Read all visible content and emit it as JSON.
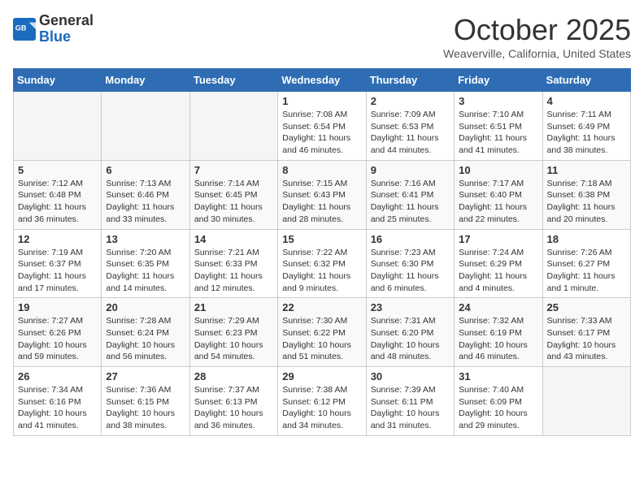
{
  "logo": {
    "line1": "General",
    "line2": "Blue"
  },
  "title": "October 2025",
  "subtitle": "Weaverville, California, United States",
  "days_of_week": [
    "Sunday",
    "Monday",
    "Tuesday",
    "Wednesday",
    "Thursday",
    "Friday",
    "Saturday"
  ],
  "weeks": [
    [
      {
        "day": "",
        "info": ""
      },
      {
        "day": "",
        "info": ""
      },
      {
        "day": "",
        "info": ""
      },
      {
        "day": "1",
        "info": "Sunrise: 7:08 AM\nSunset: 6:54 PM\nDaylight: 11 hours and 46 minutes."
      },
      {
        "day": "2",
        "info": "Sunrise: 7:09 AM\nSunset: 6:53 PM\nDaylight: 11 hours and 44 minutes."
      },
      {
        "day": "3",
        "info": "Sunrise: 7:10 AM\nSunset: 6:51 PM\nDaylight: 11 hours and 41 minutes."
      },
      {
        "day": "4",
        "info": "Sunrise: 7:11 AM\nSunset: 6:49 PM\nDaylight: 11 hours and 38 minutes."
      }
    ],
    [
      {
        "day": "5",
        "info": "Sunrise: 7:12 AM\nSunset: 6:48 PM\nDaylight: 11 hours and 36 minutes."
      },
      {
        "day": "6",
        "info": "Sunrise: 7:13 AM\nSunset: 6:46 PM\nDaylight: 11 hours and 33 minutes."
      },
      {
        "day": "7",
        "info": "Sunrise: 7:14 AM\nSunset: 6:45 PM\nDaylight: 11 hours and 30 minutes."
      },
      {
        "day": "8",
        "info": "Sunrise: 7:15 AM\nSunset: 6:43 PM\nDaylight: 11 hours and 28 minutes."
      },
      {
        "day": "9",
        "info": "Sunrise: 7:16 AM\nSunset: 6:41 PM\nDaylight: 11 hours and 25 minutes."
      },
      {
        "day": "10",
        "info": "Sunrise: 7:17 AM\nSunset: 6:40 PM\nDaylight: 11 hours and 22 minutes."
      },
      {
        "day": "11",
        "info": "Sunrise: 7:18 AM\nSunset: 6:38 PM\nDaylight: 11 hours and 20 minutes."
      }
    ],
    [
      {
        "day": "12",
        "info": "Sunrise: 7:19 AM\nSunset: 6:37 PM\nDaylight: 11 hours and 17 minutes."
      },
      {
        "day": "13",
        "info": "Sunrise: 7:20 AM\nSunset: 6:35 PM\nDaylight: 11 hours and 14 minutes."
      },
      {
        "day": "14",
        "info": "Sunrise: 7:21 AM\nSunset: 6:33 PM\nDaylight: 11 hours and 12 minutes."
      },
      {
        "day": "15",
        "info": "Sunrise: 7:22 AM\nSunset: 6:32 PM\nDaylight: 11 hours and 9 minutes."
      },
      {
        "day": "16",
        "info": "Sunrise: 7:23 AM\nSunset: 6:30 PM\nDaylight: 11 hours and 6 minutes."
      },
      {
        "day": "17",
        "info": "Sunrise: 7:24 AM\nSunset: 6:29 PM\nDaylight: 11 hours and 4 minutes."
      },
      {
        "day": "18",
        "info": "Sunrise: 7:26 AM\nSunset: 6:27 PM\nDaylight: 11 hours and 1 minute."
      }
    ],
    [
      {
        "day": "19",
        "info": "Sunrise: 7:27 AM\nSunset: 6:26 PM\nDaylight: 10 hours and 59 minutes."
      },
      {
        "day": "20",
        "info": "Sunrise: 7:28 AM\nSunset: 6:24 PM\nDaylight: 10 hours and 56 minutes."
      },
      {
        "day": "21",
        "info": "Sunrise: 7:29 AM\nSunset: 6:23 PM\nDaylight: 10 hours and 54 minutes."
      },
      {
        "day": "22",
        "info": "Sunrise: 7:30 AM\nSunset: 6:22 PM\nDaylight: 10 hours and 51 minutes."
      },
      {
        "day": "23",
        "info": "Sunrise: 7:31 AM\nSunset: 6:20 PM\nDaylight: 10 hours and 48 minutes."
      },
      {
        "day": "24",
        "info": "Sunrise: 7:32 AM\nSunset: 6:19 PM\nDaylight: 10 hours and 46 minutes."
      },
      {
        "day": "25",
        "info": "Sunrise: 7:33 AM\nSunset: 6:17 PM\nDaylight: 10 hours and 43 minutes."
      }
    ],
    [
      {
        "day": "26",
        "info": "Sunrise: 7:34 AM\nSunset: 6:16 PM\nDaylight: 10 hours and 41 minutes."
      },
      {
        "day": "27",
        "info": "Sunrise: 7:36 AM\nSunset: 6:15 PM\nDaylight: 10 hours and 38 minutes."
      },
      {
        "day": "28",
        "info": "Sunrise: 7:37 AM\nSunset: 6:13 PM\nDaylight: 10 hours and 36 minutes."
      },
      {
        "day": "29",
        "info": "Sunrise: 7:38 AM\nSunset: 6:12 PM\nDaylight: 10 hours and 34 minutes."
      },
      {
        "day": "30",
        "info": "Sunrise: 7:39 AM\nSunset: 6:11 PM\nDaylight: 10 hours and 31 minutes."
      },
      {
        "day": "31",
        "info": "Sunrise: 7:40 AM\nSunset: 6:09 PM\nDaylight: 10 hours and 29 minutes."
      },
      {
        "day": "",
        "info": ""
      }
    ]
  ]
}
